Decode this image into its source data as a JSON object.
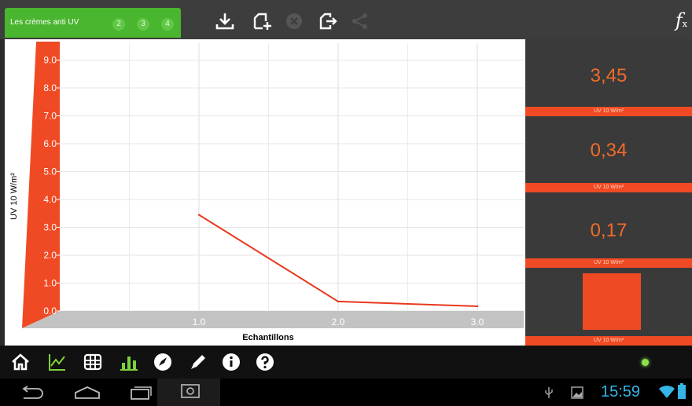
{
  "header": {
    "tab_title": "Les crèmes anti UV",
    "tab_numbers": [
      "2",
      "3",
      "4"
    ],
    "formula_symbol": "f",
    "formula_subscript": "x"
  },
  "chart_data": {
    "type": "line",
    "xlabel": "Echantillons",
    "ylabel": "UV 10 W/m²",
    "x": [
      1.0,
      2.0,
      3.0
    ],
    "series": [
      {
        "values": [
          3.45,
          0.34,
          0.17
        ]
      }
    ],
    "xlim": [
      0,
      3.2
    ],
    "ylim": [
      0,
      9.5
    ],
    "x_ticks": [
      "1.0",
      "2.0",
      "3.0"
    ],
    "y_ticks": [
      "0.0",
      "1.0",
      "2.0",
      "3.0",
      "4.0",
      "5.0",
      "6.0",
      "7.0",
      "8.0",
      "9.0"
    ],
    "grid": true,
    "colors": {
      "line": "#e8381f",
      "axis": "#f04a24",
      "floor": "#c3c3c3"
    }
  },
  "readouts": [
    {
      "value": "3,45",
      "unit": "UV 10 W/m²"
    },
    {
      "value": "0,34",
      "unit": "UV 10 W/m²"
    },
    {
      "value": "0,17",
      "unit": "UV 10 W/m²"
    },
    {
      "value": "",
      "unit": "UV 10 W/m²"
    }
  ],
  "status": {
    "time": "15:59"
  },
  "colors": {
    "accent": "#f04a24",
    "value": "#f06b2a",
    "tab": "#4ab52f",
    "clock": "#35b5e5"
  },
  "icons": {
    "toolbar": [
      "download-icon",
      "new-file-icon",
      "cancel-icon",
      "export-icon",
      "share-icon"
    ],
    "bottom": [
      "home-icon",
      "line-chart-icon",
      "table-icon",
      "bar-chart-icon",
      "compass-icon",
      "pen-icon",
      "info-icon",
      "help-icon"
    ],
    "nav": [
      "back-icon",
      "home-nav-icon",
      "recent-apps-icon",
      "screenshot-icon",
      "usb-icon",
      "gallery-icon",
      "wifi-icon",
      "battery-icon"
    ]
  }
}
